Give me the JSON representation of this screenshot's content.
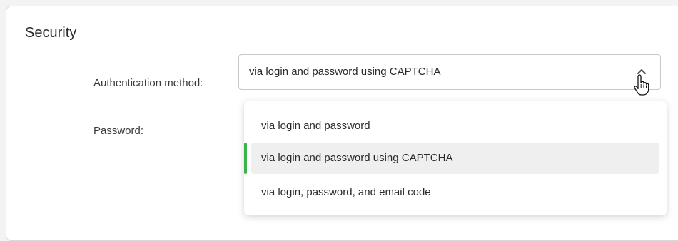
{
  "section": {
    "title": "Security"
  },
  "fields": {
    "auth_label": "Authentication method:",
    "password_label": "Password:"
  },
  "auth_select": {
    "value": "via login and password using CAPTCHA",
    "icon": "chevron-up-icon",
    "options": [
      {
        "label": "via login and password",
        "selected": false
      },
      {
        "label": "via login and password using CAPTCHA",
        "selected": true
      },
      {
        "label": "via login, password, and email code",
        "selected": false
      }
    ]
  },
  "colors": {
    "selected_accent": "#3bb54a",
    "selected_bg": "#efefef",
    "border": "#c9c9c9"
  }
}
